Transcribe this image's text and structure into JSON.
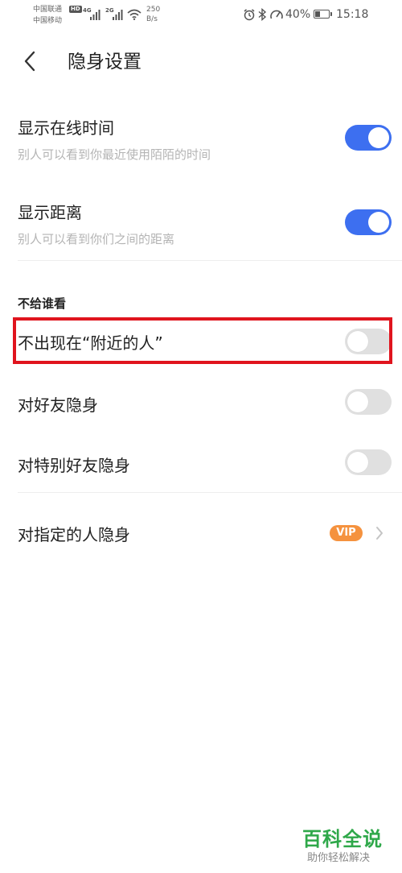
{
  "status_bar": {
    "carrier_1": "中国联通",
    "carrier_2": "中国移动",
    "hd": "HD",
    "net_1": "4G",
    "net_2": "2G",
    "speed_value": "250",
    "speed_unit": "B/s",
    "battery_text": "40%",
    "battery_level": 0.4,
    "time": "15:18",
    "icons": [
      "alarm-icon",
      "bluetooth-icon",
      "speed-meter-icon",
      "battery-icon"
    ]
  },
  "header": {
    "title": "隐身设置",
    "back_icon": "chevron-left-icon"
  },
  "settings": {
    "show_online_time": {
      "title": "显示在线时间",
      "description": "别人可以看到你最近使用陌陌的时间",
      "enabled": true
    },
    "show_distance": {
      "title": "显示距离",
      "description": "别人可以看到你们之间的距离",
      "enabled": true
    },
    "section_label": "不给谁看",
    "hide_from_nearby": {
      "title": "不出现在“附近的人”",
      "enabled": false
    },
    "hide_from_friends": {
      "title": "对好友隐身",
      "enabled": false
    },
    "hide_from_special_friends": {
      "title": "对特别好友隐身",
      "enabled": false
    },
    "hide_from_specific": {
      "title": "对指定的人隐身",
      "badge": "VIP"
    }
  },
  "colors": {
    "toggle_on": "#3d6ff0",
    "toggle_off": "#e0e0e0",
    "highlight": "#e0141e",
    "vip": "#f5923e",
    "watermark": "#2fa84a"
  },
  "watermark": {
    "title": "百科全说",
    "subtitle": "助你轻松解决"
  }
}
